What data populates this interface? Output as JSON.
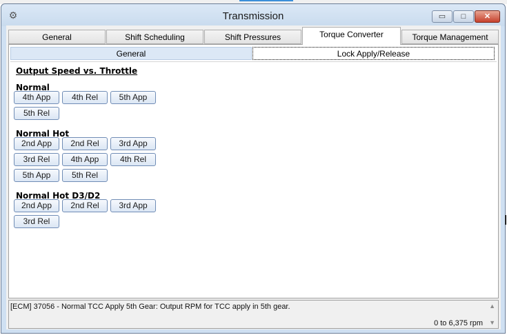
{
  "window": {
    "title": "Transmission",
    "icon": "gear-icon",
    "controls": {
      "minimize": "▭",
      "maximize": "□",
      "close": "✕"
    }
  },
  "tabs": [
    {
      "label": "General",
      "active": false
    },
    {
      "label": "Shift Scheduling",
      "active": false
    },
    {
      "label": "Shift Pressures",
      "active": false
    },
    {
      "label": "Torque Converter",
      "active": true
    },
    {
      "label": "Torque Management",
      "active": false
    }
  ],
  "subtabs": [
    {
      "label": "General",
      "active": false
    },
    {
      "label": "Lock Apply/Release",
      "active": true
    }
  ],
  "content": {
    "heading": "Output Speed vs. Throttle",
    "sections": [
      {
        "label": "Normal",
        "buttons": [
          "4th App",
          "4th Rel",
          "5th App",
          "5th Rel"
        ]
      },
      {
        "label": "Normal Hot",
        "buttons": [
          "2nd App",
          "2nd Rel",
          "3rd App",
          "3rd Rel",
          "4th App",
          "4th Rel",
          "5th App",
          "5th Rel"
        ]
      },
      {
        "label": "Normal Hot D3/D2",
        "buttons": [
          "2nd App",
          "2nd Rel",
          "3rd App",
          "3rd Rel"
        ]
      }
    ]
  },
  "status": {
    "description": "[ECM] 37056 - Normal TCC Apply 5th Gear: Output RPM for TCC apply in 5th gear.",
    "range": "0 to 6,375 rpm"
  },
  "colors": {
    "title_bar": "#c9dbee",
    "button_border": "#6f8cb5",
    "close_button": "#c7412c",
    "subtab_selected_bg": "#dce8f6"
  }
}
